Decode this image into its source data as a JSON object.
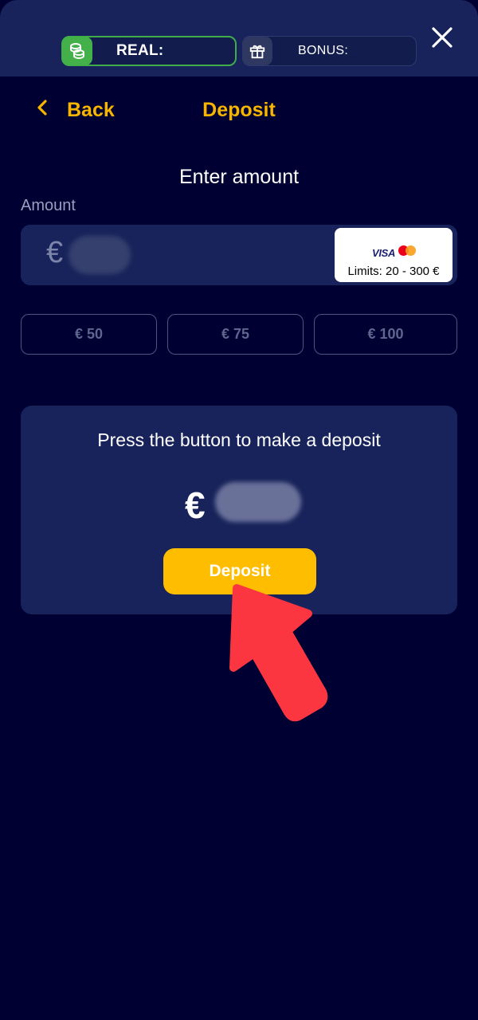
{
  "header": {
    "real_label": "REAL:",
    "bonus_label": "BONUS:"
  },
  "nav": {
    "back_label": "Back",
    "title": "Deposit"
  },
  "form": {
    "heading": "Enter amount",
    "amount_label": "Amount",
    "currency_symbol": "€",
    "limits_text": "Limits: 20 - 300 €",
    "card_brand": "VISA",
    "quick_amounts": [
      "€ 50",
      "€ 75",
      "€ 100"
    ]
  },
  "summary": {
    "instruction": "Press the button to make a deposit",
    "currency_symbol": "€",
    "deposit_button": "Deposit"
  },
  "colors": {
    "background": "#000033",
    "panel": "#17235a",
    "accent": "#f7b500",
    "real_green": "#43b04a",
    "arrow_red": "#fb3640"
  }
}
